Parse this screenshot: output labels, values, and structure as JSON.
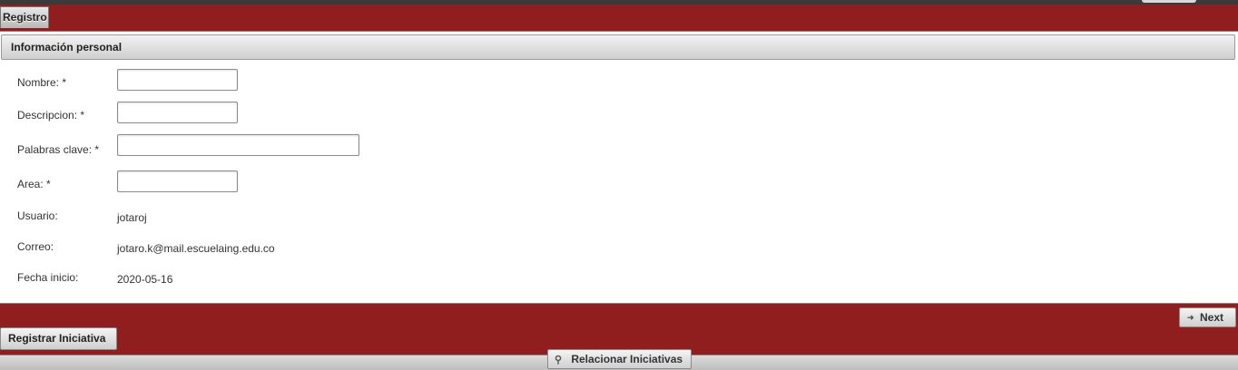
{
  "tab": {
    "label": "Registro"
  },
  "fieldset": {
    "title": "Información personal"
  },
  "fields": [
    {
      "label": "Nombre:  *",
      "value": "",
      "placeholder": ""
    },
    {
      "label": "Descripcion:  *",
      "value": "",
      "placeholder": ""
    },
    {
      "label": "Palabras clave:  *",
      "value": "",
      "placeholder": ""
    },
    {
      "label": "Area:  *",
      "value": "",
      "placeholder": ""
    }
  ],
  "info": [
    {
      "label": "Usuario:",
      "value": "jotaroj"
    },
    {
      "label": "Correo:",
      "value": "jotaro.k@mail.escuelaing.edu.co"
    },
    {
      "label": "Fecha inicio:",
      "value": "2020-05-16"
    }
  ],
  "wizard": {
    "next_label": "Next",
    "next_icon": "arrow-right-icon"
  },
  "actions": {
    "registrar_label": "Registrar Iniciativa",
    "relacionar_label": "Relacionar Iniciativas",
    "relacionar_icon": "search-icon"
  },
  "colors": {
    "brand_background": "#911e1f",
    "panel_background": "#ffffff"
  }
}
